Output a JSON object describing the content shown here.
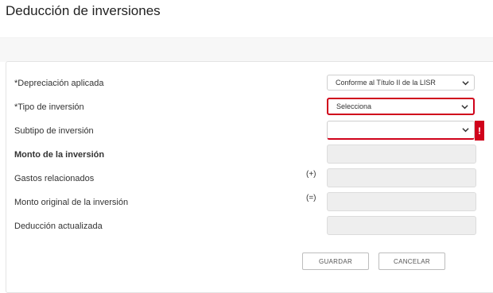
{
  "page": {
    "title": "Deducción de inversiones"
  },
  "form": {
    "depreciacion": {
      "label": "*Depreciación aplicada",
      "value": "Conforme al Título II de la LISR"
    },
    "tipo": {
      "label": "*Tipo de inversión",
      "value": "Selecciona"
    },
    "subtipo": {
      "label": "Subtipo de inversión",
      "value": "",
      "alert": "!"
    },
    "monto": {
      "label": "Monto de la inversión"
    },
    "gastos": {
      "label": "Gastos relacionados",
      "operator": "(+)"
    },
    "monto_original": {
      "label": "Monto original de la inversión",
      "operator": "(=)"
    },
    "deduccion": {
      "label": "Deducción actualizada"
    }
  },
  "buttons": {
    "save": "GUARDAR",
    "cancel": "CANCELAR"
  },
  "colors": {
    "error": "#d0021b",
    "disabled_field": "#eeeeee"
  },
  "icons": {
    "dropdown": "chevron-down-icon",
    "alert": "exclamation-icon"
  }
}
